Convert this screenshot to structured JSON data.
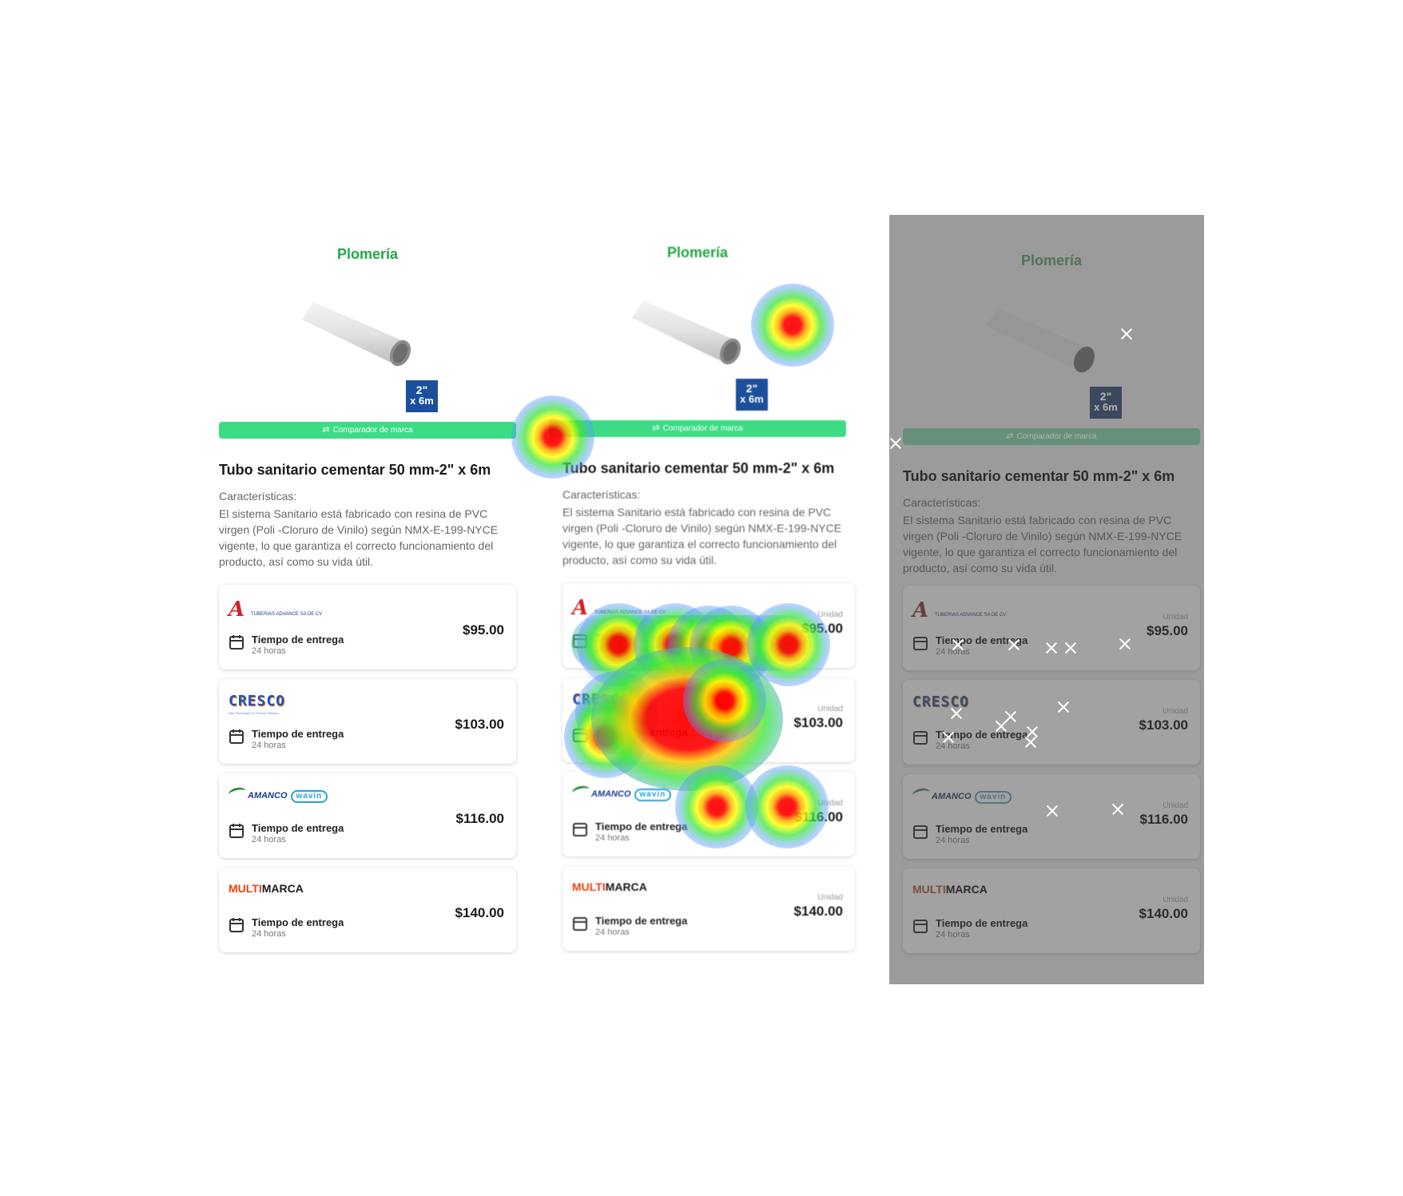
{
  "category": "Plomería",
  "badge": {
    "line1": "2\"",
    "line2": "x 6m"
  },
  "compare_label": "Comparador de marca",
  "product": {
    "title": "Tubo sanitario cementar 50 mm-2\" x 6m",
    "characteristics_label": "Características:",
    "description": "El sistema Sanitario está fabricado con resina de PVC virgen (Poli -Cloruro de Vinilo) según NMX-E-199-NYCE vigente, lo que garantiza el correcto funcionamiento del producto, así como su vida útil."
  },
  "offers": [
    {
      "brand": "Tuberías Advance",
      "logo_text": "TUBERIAS ADVANCE SA DE CV",
      "delivery_label": "Tiempo de entrega",
      "delivery_time": "24 horas",
      "unit": "Unidad",
      "price": "$95.00"
    },
    {
      "brand": "Cresco",
      "logo_text": "CRESCO",
      "logo_sub": "Alta Tecnología en Tubería Plástica",
      "delivery_label": "Tiempo de entrega",
      "delivery_time": "24 horas",
      "unit": "Unidad",
      "price": "$103.00"
    },
    {
      "brand": "Amanco Wavin",
      "logo_text": "AMANCO",
      "logo_text2": "wavin",
      "delivery_label": "Tiempo de entrega",
      "delivery_time": "24 horas",
      "unit": "Unidad",
      "price": "$116.00"
    },
    {
      "brand": "MultiMarca",
      "logo_text": "MULTI",
      "logo_text2": "MARCA",
      "delivery_label": "Tiempo de entrega",
      "delivery_time": "24 horas",
      "unit": "Unidad",
      "price": "$140.00"
    }
  ],
  "colors": {
    "accent_green": "#22a745",
    "compare_bar": "#3ddc84",
    "badge_blue": "#1b4f9c",
    "overlay_gray": "#9b9b9b"
  }
}
